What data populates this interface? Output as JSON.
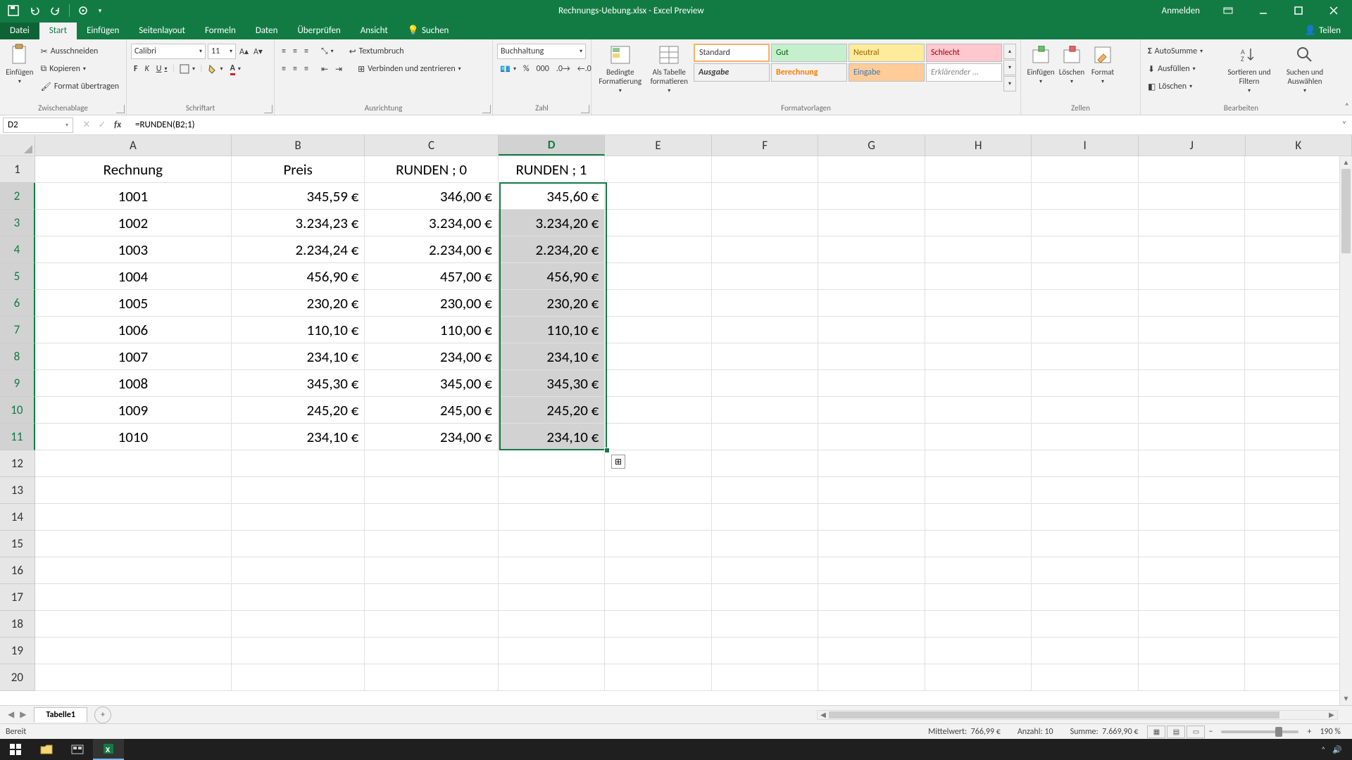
{
  "app": {
    "title": "Rechnungs-Uebung.xlsx - Excel Preview",
    "signin": "Anmelden"
  },
  "tabs": {
    "file": "Datei",
    "start": "Start",
    "einfuegen": "Einfügen",
    "seitenlayout": "Seitenlayout",
    "formeln": "Formeln",
    "daten": "Daten",
    "ueberpruefen": "Überprüfen",
    "ansicht": "Ansicht",
    "suchen": "Suchen",
    "teilen": "Teilen"
  },
  "ribbon": {
    "clipboard": {
      "paste": "Einfügen",
      "cut": "Ausschneiden",
      "copy": "Kopieren",
      "format_painter": "Format übertragen",
      "group": "Zwischenablage"
    },
    "font": {
      "name": "Calibri",
      "size": "11",
      "group": "Schriftart"
    },
    "align": {
      "wrap": "Textumbruch",
      "merge": "Verbinden und zentrieren",
      "group": "Ausrichtung"
    },
    "number": {
      "format": "Buchhaltung",
      "group": "Zahl"
    },
    "styles": {
      "cond": "Bedingte Formatierung",
      "table": "Als Tabelle formatieren",
      "standard": "Standard",
      "gut": "Gut",
      "neutral": "Neutral",
      "schlecht": "Schlecht",
      "ausgabe": "Ausgabe",
      "berechnung": "Berechnung",
      "eingabe": "Eingabe",
      "erklaerend": "Erklärender ...",
      "group": "Formatvorlagen"
    },
    "cells": {
      "insert": "Einfügen",
      "delete": "Löschen",
      "format": "Format",
      "group": "Zellen"
    },
    "editing": {
      "autosum": "AutoSumme",
      "fill": "Ausfüllen",
      "clear": "Löschen",
      "sort": "Sortieren und Filtern",
      "find": "Suchen und Auswählen",
      "group": "Bearbeiten"
    }
  },
  "fbar": {
    "name": "D2",
    "formula": "=RUNDEN(B2;1)"
  },
  "columns": [
    "A",
    "B",
    "C",
    "D",
    "E",
    "F",
    "G",
    "H",
    "I",
    "J",
    "K"
  ],
  "col_sel_index": 3,
  "row_sel_start": 2,
  "row_sel_end": 11,
  "headers": {
    "A": "Rechnung",
    "B": "Preis",
    "C": "RUNDEN ; 0",
    "D": "RUNDEN ; 1"
  },
  "rows": [
    {
      "A": "1001",
      "B": "345,59 €",
      "C": "346,00 €",
      "D": "345,60 €"
    },
    {
      "A": "1002",
      "B": "3.234,23 €",
      "C": "3.234,00 €",
      "D": "3.234,20 €"
    },
    {
      "A": "1003",
      "B": "2.234,24 €",
      "C": "2.234,00 €",
      "D": "2.234,20 €"
    },
    {
      "A": "1004",
      "B": "456,90 €",
      "C": "457,00 €",
      "D": "456,90 €"
    },
    {
      "A": "1005",
      "B": "230,20 €",
      "C": "230,00 €",
      "D": "230,20 €"
    },
    {
      "A": "1006",
      "B": "110,10 €",
      "C": "110,00 €",
      "D": "110,10 €"
    },
    {
      "A": "1007",
      "B": "234,10 €",
      "C": "234,00 €",
      "D": "234,10 €"
    },
    {
      "A": "1008",
      "B": "345,30 €",
      "C": "345,00 €",
      "D": "345,30 €"
    },
    {
      "A": "1009",
      "B": "245,20 €",
      "C": "245,00 €",
      "D": "245,20 €"
    },
    {
      "A": "1010",
      "B": "234,10 €",
      "C": "234,00 €",
      "D": "234,10 €"
    }
  ],
  "total_rows": 20,
  "sheet": {
    "name": "Tabelle1"
  },
  "status": {
    "ready": "Bereit",
    "avg_label": "Mittelwert:",
    "avg": "766,99 €",
    "count_label": "Anzahl:",
    "count": "10",
    "sum_label": "Summe:",
    "sum": "7.669,90 €",
    "zoom": "190 %"
  }
}
